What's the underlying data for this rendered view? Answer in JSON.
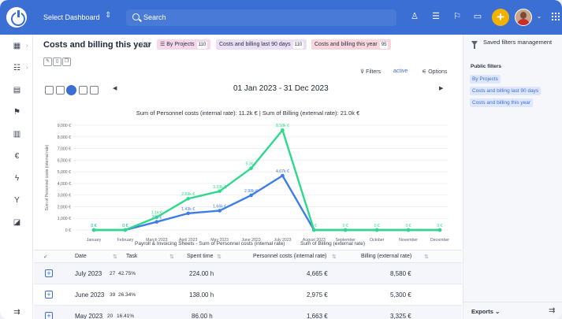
{
  "topbar": {
    "dashboard_select": "Select Dashboard",
    "search_placeholder": "Search",
    "plus_label": "+"
  },
  "page": {
    "title": "Costs and billing this year",
    "count": "(95)",
    "chips": [
      {
        "label": "By Projects",
        "count": "110",
        "color": "#f5d9ea"
      },
      {
        "label": "Costs and billing last 90 days",
        "count": "110",
        "color": "#ebdff5"
      },
      {
        "label": "Costs and billing this year",
        "count": "95",
        "color": "#f8d6dd"
      }
    ],
    "filters_label": "Filters",
    "filters_state": "active",
    "options_label": "Options",
    "date_range": "01 Jan 2023 - 31 Dec 2023"
  },
  "chart_data": {
    "type": "line",
    "title": "Sum of Personnel costs (internal rate): 11.2k € | Sum of Billing (external rate): 21.0k €",
    "xlabel": "",
    "ylabel": "Sum of Personnel costs (internal rate)",
    "ylim": [
      0,
      9000
    ],
    "yticks": [
      "0 €",
      "1,000 €",
      "2,000 €",
      "3,000 €",
      "4,000 €",
      "5,000 €",
      "6,000 €",
      "7,000 €",
      "8,000 €",
      "9,000 €"
    ],
    "categories": [
      "January",
      "February",
      "March 2023",
      "April 2023",
      "May 2023",
      "June 2023",
      "July 2023",
      "August 2023",
      "September",
      "October",
      "November",
      "December"
    ],
    "series": [
      {
        "name": "Payroll & Invoicing Sheets - Sum of Personnel costs (internal rate)",
        "color": "#3d7de8",
        "values": [
          0,
          0,
          700,
          1430,
          1660,
          2980,
          4670,
          0,
          0,
          0,
          0,
          0
        ],
        "labels": [
          "0 €",
          "0 €",
          "700 €",
          "1.43k €",
          "1.66k €",
          "2.98k €",
          "4.67k €",
          "",
          "",
          "",
          "",
          ""
        ]
      },
      {
        "name": "Sum of Billing (external rate)",
        "color": "#2fd98a",
        "values": [
          0,
          0,
          1100,
          2690,
          3330,
          5300,
          8580,
          0,
          0,
          0,
          0,
          0
        ],
        "labels": [
          "0 €",
          "0 €",
          "1.1k €",
          "2.69k €",
          "3.33k €",
          "5.3k €",
          "8.58k €",
          "0 €",
          "0 €",
          "0 €",
          "0 €",
          "0 €"
        ]
      }
    ],
    "grid": true,
    "legend_position": "bottom"
  },
  "table": {
    "headers": [
      "Date",
      "Task",
      "Spent time",
      "Personnel costs (internal rate)",
      "Billing (external rate)"
    ],
    "rows": [
      {
        "date": "July 2023",
        "task_count": "27",
        "task_pct": "42.75%",
        "spent": "224.00 h",
        "personnel": "4,665 €",
        "billing": "8,580 €"
      },
      {
        "date": "June 2023",
        "task_count": "39",
        "task_pct": "26.34%",
        "spent": "138.00 h",
        "personnel": "2,975 €",
        "billing": "5,300 €"
      },
      {
        "date": "May 2023",
        "task_count": "20",
        "task_pct": "16.41%",
        "spent": "86.00 h",
        "personnel": "1,663 €",
        "billing": "3,325 €"
      }
    ]
  },
  "rightbar": {
    "title": "Saved filters management",
    "public_heading": "Public filters",
    "items": [
      "By Projects",
      "Costs and billing last 90 days",
      "Costs and billing this year"
    ],
    "exports_label": "Exports"
  }
}
